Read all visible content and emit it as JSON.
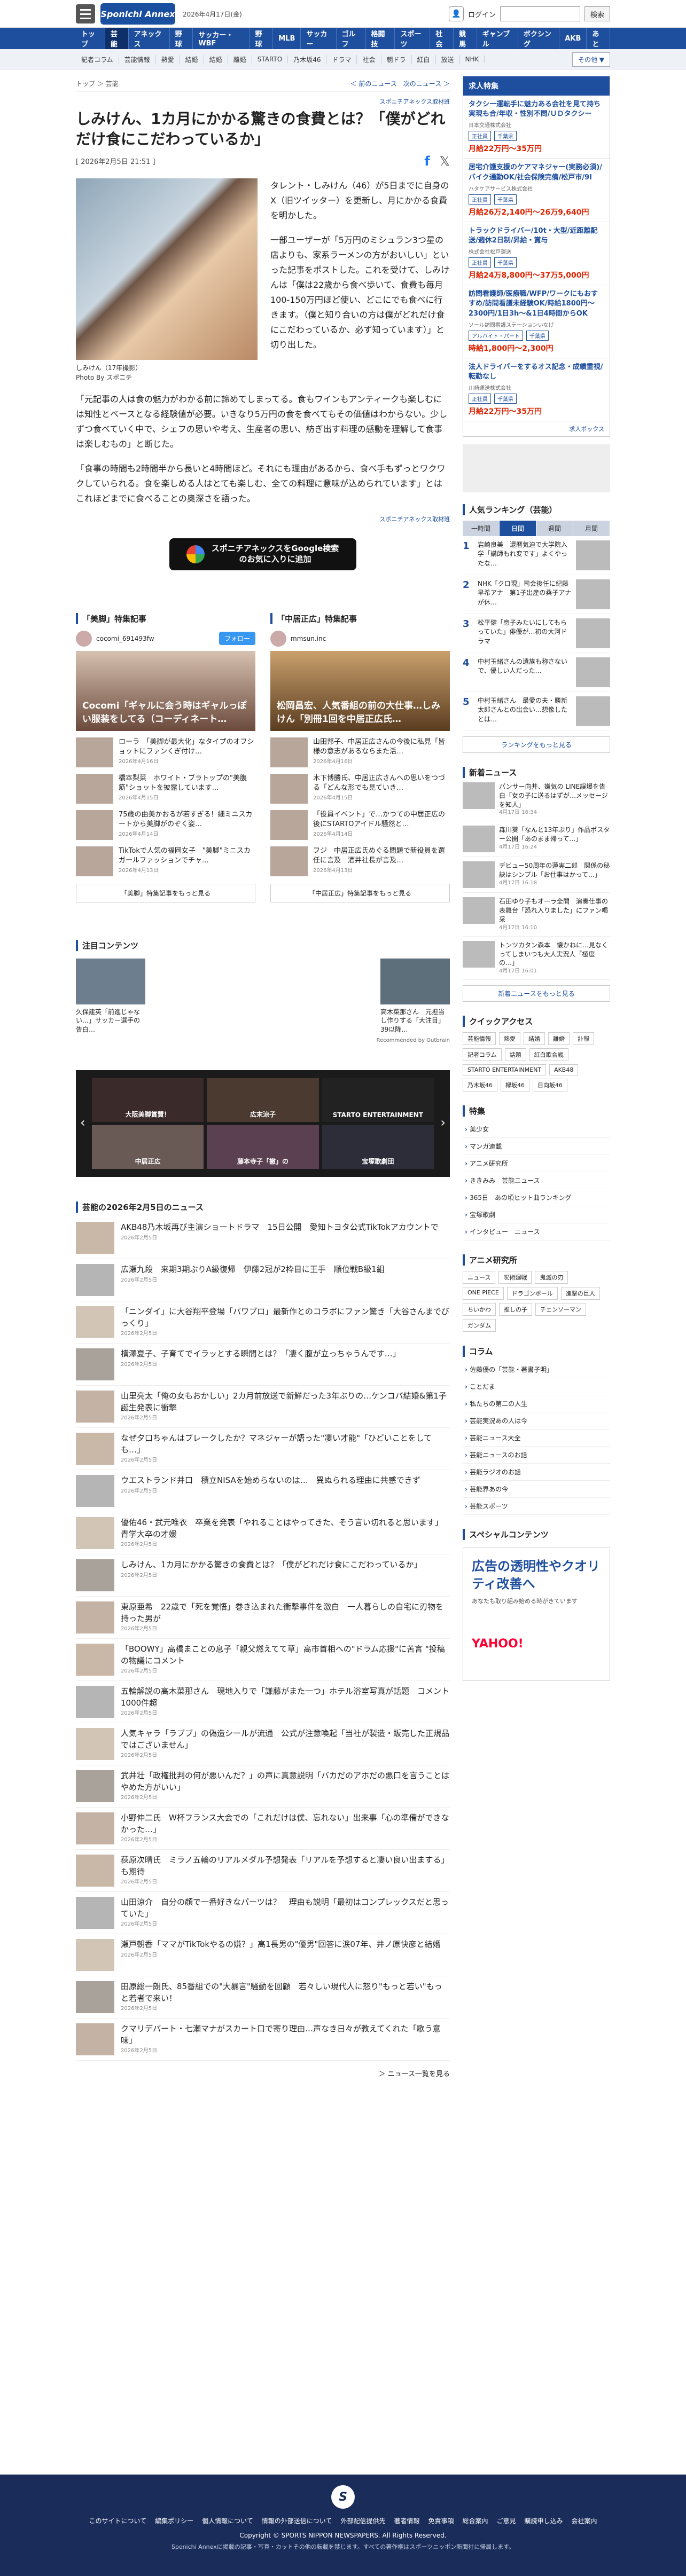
{
  "header": {
    "logo": "Sponichi Annex",
    "date": "2026年4月17日(金)",
    "login": "ログイン",
    "search_btn": "検索"
  },
  "nav1": [
    "トップ",
    "芸能",
    "アネックス",
    "野球",
    "サッカー・WBF",
    "野球",
    "MLB",
    "サッカー",
    "ゴルフ",
    "格闘技",
    "スポーツ",
    "社会",
    "競馬",
    "ギャンブル",
    "ボクシング",
    "AKB",
    "あと"
  ],
  "nav2": [
    "記者コラム",
    "芸能情報",
    "熱愛",
    "結婚",
    "結婚",
    "離婚",
    "STARTO",
    "乃木坂46",
    "ドラマ",
    "社会",
    "朝ドラ",
    "紅白",
    "放送",
    "NHK"
  ],
  "nav2_more": "その他 ▼",
  "crumb": {
    "path": "トップ ＞ 芸能",
    "prev": "＜ 前のニュース",
    "next": "次のニュース ＞"
  },
  "article": {
    "credit": "スポニチアネックス取材班",
    "title": "しみけん、1カ月にかかる驚きの食費とは？「僕がどれだけ食にこだわっているか」",
    "date": "[ 2026年2月5日 21:51 ]",
    "caption": "しみけん（17年撮影）",
    "caption2": "Photo By スポニチ",
    "p1": "タレント・しみけん（46）が5日までに自身のX（旧ツイッター）を更新し、月にかかる食費を明かした。",
    "p2": "一部ユーザーが「5万円のミシュラン3つ星の店よりも、家系ラーメンの方がおいしい」といった記事をポストした。これを受けて、しみけんは「僕は22歳から食べ歩いて、食費も毎月100-150万円ほど使い、どこにでも食べに行きます。（僕と知り合いの方は僕がどれだけ食にこだわっているか、必ず知っています）」と切り出した。",
    "p3": "「元記事の人は食の魅力がわかる前に諦めてしまってる。食もワインもアンティークも楽しむには知性とベースとなる経験値が必要。いきなり5万円の食を食べてもその価値はわからない。少しずつ食べていく中で、シェフの思いや考え、生産者の思い、紡ぎ出す料理の感動を理解して食事は楽しむもの」と断じた。",
    "p4": "「食事の時間も2時間半から長いと4時間ほど。それにも理由があるから、食べ手もずっとワクワクしていられる。食を楽しめる人はとても楽しむ、全ての料理に意味が込められています」とはこれほどまでに食べることの奥深さを語った。",
    "credit2": "スポニチアネックス取材班",
    "gbtn": "スポニチアネックスをGoogle検索のお気に入りに追加"
  },
  "feat": {
    "left": {
      "title": "「美脚」特集記事",
      "account": "cocomi_691493fw",
      "follow": "フォロー",
      "big": "Cocomi「ギャルに会う時はギャルっぽい服装をしてる（コーディネート…",
      "items": [
        {
          "t": "ローラ　「美脚が最大化」なタイプのオフショットにファンくぎ付け…",
          "d": "2026年4月16日"
        },
        {
          "t": "橋本梨菜　ホワイト・ブラトップの\"美腹筋\"ショットを披露しています…",
          "d": "2026年4月15日"
        },
        {
          "t": "75歳の由美かおるが若すぎる！細ミニスカートから美脚がのぞく姿…",
          "d": "2026年4月14日"
        },
        {
          "t": "TikTokで人気の福岡女子　\"美脚\"ミニスカガールファッションでチャ…",
          "d": "2026年4月13日"
        }
      ],
      "more": "「美脚」特集記事をもっと見る"
    },
    "right": {
      "title": "「中居正広」特集記事",
      "account": "mmsun.inc",
      "big": "松岡昌宏、人気番組の前の大仕事…しみけん「別冊1回を中居正広氏…",
      "items": [
        {
          "t": "山田邦子、中居正広さんの今後に私見「皆様の意志があるならまた活…",
          "d": "2026年4月16日"
        },
        {
          "t": "木下博勝氏、中居正広さんへの思いをつづる「どんな形でも見ていき…",
          "d": "2026年4月15日"
        },
        {
          "t": "「役員イベント」で…かつての中居正広の後にSTARTOアイドル騒然と…",
          "d": "2026年4月14日"
        },
        {
          "t": "フジ　中居正広氏めぐる問題で新役員を選任に言及　酒井社長が言及…",
          "d": "2026年4月13日"
        }
      ],
      "more": "「中居正広」特集記事をもっと見る"
    }
  },
  "attn": {
    "title": "注目コンテンツ",
    "items": [
      "久保建英「前進じゃない…」サッカー選手の告白…",
      "",
      "",
      "",
      "高木菜那さん　元担当し作りする「大注目」39以降…"
    ],
    "uz": "Recommended by Outbrain"
  },
  "carousel": [
    "大阪美脚賞賛！",
    "広末涼子",
    "STARTO ENTERTAINMENT",
    "中居正広",
    "藤本寺子「撤」の",
    "宝塚歌劇団"
  ],
  "newslist": {
    "title": "芸能の2026年2月5日のニュース",
    "items": [
      {
        "t": "AKB48乃木坂再び主演ショートドラマ　15日公開　愛知トヨタ公式TikTokアカウントで",
        "d": "2026年2月5日"
      },
      {
        "t": "広瀬九段　来期3期ぶりA級復帰　伊藤2冠が2枠目に王手　順位戦B級1組",
        "d": "2026年2月5日"
      },
      {
        "t": "「ニンダイ」に大谷翔平登場「パワプロ」最新作とのコラボにファン驚き「大谷さんまでびっくり」",
        "d": "2026年2月5日"
      },
      {
        "t": "横澤夏子、子育てでイラッとする瞬間とは？「凄く腹が立っちゃうんです…」",
        "d": "2026年2月5日"
      },
      {
        "t": "山里亮太「俺の女もおかしい」2カ月前放送で新鮮だった3年ぶりの…ケンコバ結婚&第1子誕生発表に衝撃",
        "d": "2026年2月5日"
      },
      {
        "t": "なぜ夕口ちゃんはブレークしたか？マネジャーが語った\"凄い才能\"「ひどいことをしても…」",
        "d": "2026年2月5日"
      },
      {
        "t": "ウエストランド井口　積立NISAを始めらないのは…　異ぬられる理由に共感できず",
        "d": "2026年2月5日"
      },
      {
        "t": "優佑46・武元唯衣　卒業を発表「やれることはやってきた、そう言い切れると思います」　青学大卒の才媛",
        "d": "2026年2月5日"
      },
      {
        "t": "しみけん、1カ月にかかる驚きの食費とは？「僕がどれだけ食にこだわっているか」",
        "d": "2026年2月5日"
      },
      {
        "t": "東原亜希　22歳で「死を覚悟」巻き込まれた衝撃事件を激白　一人暮らしの自宅に刃物を持った男が",
        "d": "2026年2月5日"
      },
      {
        "t": "「BOOWY」高橋まことの息子「親父燃えてて草」高市首相への\"ドラム応援\"に苦言 \"投稿の物議にコメント",
        "d": "2026年2月5日"
      },
      {
        "t": "五輪解説の高木菜那さん　現地入りで「謙藤がまた一つ」ホテル浴室写真が話題　コメント1000件超",
        "d": "2026年2月5日"
      },
      {
        "t": "人気キャラ「ラブブ」の偽造シールが流通　公式が注意喚起「当社が製造・販売した正規品ではございません」",
        "d": "2026年2月5日"
      },
      {
        "t": "武井壮「政権批判の何が悪いんだ？」の声に真意説明「バカだのアホだの悪口を言うことはやめた方がいい」",
        "d": "2026年2月5日"
      },
      {
        "t": "小野伸二氏　W杯フランス大会での「これだけは僕、忘れない」出来事「心の準備ができなかった…」",
        "d": "2026年2月5日"
      },
      {
        "t": "荻原次晴氏　ミラノ五輪のリアルメダル予想発表「リアルを予想すると凄い良い出まする」も期待",
        "d": "2026年2月5日"
      },
      {
        "t": "山田涼介　自分の顔で一番好きなパーツは？　理由も説明「最初はコンプレックスだと思っていた」",
        "d": "2026年2月5日"
      },
      {
        "t": "瀬戸朝香「ママがTikTokやるの嫌？」高1長男の\"優男\"回答に涙07年、井ノ原快彦と結婚",
        "d": "2026年2月5日"
      },
      {
        "t": "田原総一朗氏、85番組での\"大暴言\"騒動を回顧　若々しい現代人に怒り\"もっと若い\"もっと若者で来い！",
        "d": "2026年2月5日"
      },
      {
        "t": "クマリデパート・七瀬マナがスカート口で寄り理由…声なき日々が教えてくれた「歌う意味」",
        "d": "2026年2月5日"
      }
    ],
    "more": "＞ ニュース一覧を見る"
  },
  "side": {
    "job": {
      "title": "求人特集",
      "items": [
        {
          "t": "タクシー運転手に魅力ある会社を見て持ち実現も合/年収・性別不問/ＵＤタクシー",
          "co": "日本交通株式会社",
          "tags": [
            "正社員",
            "千葉県"
          ],
          "pay": "月給22万円〜35万円"
        },
        {
          "t": "居宅介護支援のケアマネジャー(実務必須)/バイク通勤OK/社会保険完備/松戸市/9I",
          "co": "ハタケアサービス株式会社",
          "tags": [
            "正社員",
            "千葉県"
          ],
          "pay": "月給26万2,140円〜26万9,640円"
        },
        {
          "t": "トラックドライバー/10t・大型/近距離配送/週休2日制/昇給・賞与",
          "co": "株式会社松戸運送",
          "tags": [
            "正社員",
            "千葉県"
          ],
          "pay": "月給24万8,800円〜37万5,000円"
        },
        {
          "t": "訪問看護師/医療職/WFP/ワークにもおすすめ/訪問看護未経験OK/時給1800円〜2300円/1日3h〜&1日4時間からOK",
          "co": "ソール訪問看護ステーションいなげ",
          "tags": [
            "アルバイト・パート",
            "千葉県"
          ],
          "pay": "時給1,800円〜2,300円"
        },
        {
          "t": "法人ドライバーをするオス記念・成績重視/転勤なし",
          "co": "川崎運送株式会社",
          "tags": [
            "正社員",
            "千葉県"
          ],
          "pay": "月給22万円〜35万円"
        }
      ],
      "footer": "求人ボックス"
    },
    "rank": {
      "title": "人気ランキング（芸能）",
      "tabs": [
        "一時間",
        "日間",
        "週間",
        "月間"
      ],
      "items": [
        "岩崎良美　還暦気迫で大学院入学「講師もれ変です」よくやったな…",
        "NHK「クロ現」司会後任に紀藤早希アナ　第1子出産の桑子アナが休…",
        "松平健「息子みたいにしてもらっていた」俳優が…初の大河ドラマ",
        "中村玉緒さんの遺族も称さないで、優しい人だった…",
        "中村玉緒さん　最愛の夫・勝新太郎さんとの出会い…想像したとは…"
      ],
      "more": "ランキングをもっと見る"
    },
    "newart": {
      "title": "新着ニュース",
      "items": [
        {
          "t": "パンサー向井、嫌気の LINE誤爆を告白「女の子に送るはずが…メッセージを知人」",
          "d": "4月17日 16:34"
        },
        {
          "t": "森川葵「なんと13年ぶり」作品ポスター公開「あのまま帰って…」",
          "d": "4月17日 16:24"
        },
        {
          "t": "デビュー50周年の蓮実二郎　関係の秘訣はシンプル「お仕事はかって…」",
          "d": "4月17日 16:18"
        },
        {
          "t": "石田ゆり子もオーラ全開　演奏仕事の表舞台「恐れ入りました」にファン喝采",
          "d": "4月17日 16:10"
        },
        {
          "t": "トンツカタン森本　懐かねに…見なくってしまいつも大人実況人「極度の…」",
          "d": "4月17日 16:01"
        }
      ],
      "more": "新着ニュースをもっと見る"
    },
    "quick": {
      "title": "クイックアクセス",
      "links": [
        "芸能情報",
        "熱愛",
        "結婚",
        "離婚",
        "訃報",
        "記者コラム",
        "話題",
        "紅白歌合戦",
        "STARTO ENTERTAINMENT",
        "AKB48",
        "乃木坂46",
        "欅坂46",
        "日向坂46"
      ]
    },
    "toku": {
      "title": "特集",
      "links": [
        "美少女",
        "マンガ連載",
        "アニメ研究所",
        "ききみみ　芸能ニュース",
        "365日　あの頃ヒット曲ランキング",
        "宝塚歌劇",
        "インタビュー　ニュース"
      ]
    },
    "anime": {
      "title": "アニメ研究所",
      "links": [
        "ニュース",
        "呪術廻戦",
        "鬼滅の刃",
        "ONE PIECE",
        "ドラゴンボール",
        "進撃の巨人",
        "ちいかわ",
        "推しの子",
        "チェンソーマン",
        "ガンダム"
      ]
    },
    "column": {
      "title": "コラム",
      "links": [
        "佐藤優の「芸能・著書子明」",
        "ことだま",
        "私たちの第二の人生",
        "芸能実況あの人は今",
        "芸能ニュース大全",
        "芸能ニュースのお話",
        "芸能ラジオのお話",
        "芸能界あの今",
        "芸能スポーツ"
      ]
    },
    "special": {
      "title": "スペシャルコンテンツ"
    },
    "ad": {
      "big": "広告の透明性やクオリティ改善へ",
      "sm": "あなたも取り組み始める時がきています",
      "yh": "YAHOO!"
    }
  },
  "footer": {
    "logo": "S",
    "links": [
      "このサイトについて",
      "編集ポリシー",
      "個人情報について",
      "情報の外部送信について",
      "外部配信提供先",
      "著者情報",
      "免責事項",
      "総合案内",
      "ご意見",
      "購読申し込み",
      "会社案内"
    ],
    "copy": "Copyright © SPORTS NIPPON NEWSPAPERS. All Rights Reserved.",
    "note": "Sponichi Annexに掲載の記事・写真・カットその他の転載を禁じます。すべての著作権はスポーツニッポン新聞社に帰属します。"
  }
}
